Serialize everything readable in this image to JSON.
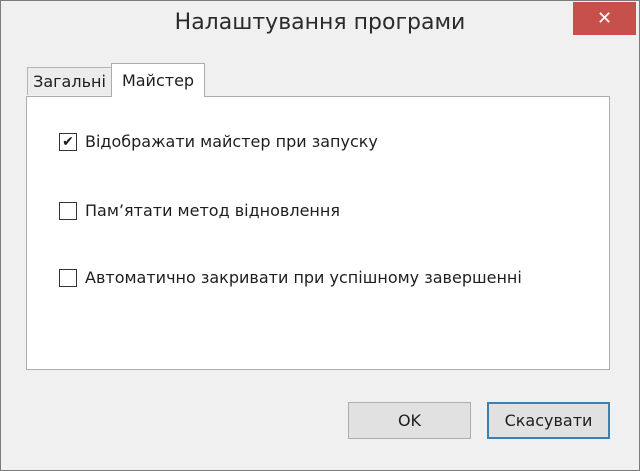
{
  "window": {
    "title": "Налаштування програми"
  },
  "titlebar": {
    "close_icon": "close-icon",
    "close_symbol": "✕",
    "close_color": "#c7504b"
  },
  "tabs": [
    {
      "label": "Загальні",
      "selected": false
    },
    {
      "label": "Майстер",
      "selected": true
    }
  ],
  "options": [
    {
      "label": "Відображати майстер при запуску",
      "checked": true
    },
    {
      "label": "Пам’ятати метод відновлення",
      "checked": false
    },
    {
      "label": "Автоматично закривати при успішному завершенні",
      "checked": false
    }
  ],
  "buttons": {
    "ok_label": "OK",
    "cancel_label": "Скасувати"
  },
  "check_symbol": "✔"
}
